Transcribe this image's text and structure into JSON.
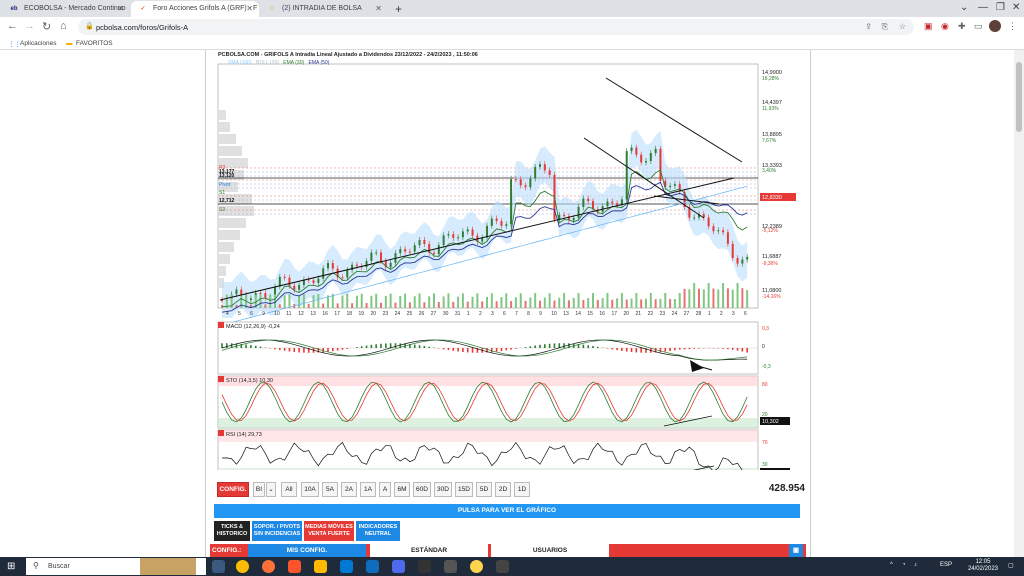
{
  "tabs": [
    {
      "label": "ECOBOLSA - Mercado Continuo",
      "fav": "eb",
      "favcolor": "#1a237e"
    },
    {
      "label": "Foro Acciones Grifols A (GRF) - F",
      "fav": "✓",
      "favcolor": "#ff5722"
    },
    {
      "label": "(2) INTRADIA DE BOLSA",
      "fav": "☺",
      "favcolor": "#ffc107"
    }
  ],
  "url": "pcbolsa.com/foros/Grifols-A",
  "bookmarks": [
    "Aplicaciones",
    "FAVORITOS"
  ],
  "chart": {
    "title": "PCBOLSA.COM - GRIFOLS A Intradía Lineal Ajustado a Dividendos 23/12/2022 - 24/2/2023 , 11:50:06",
    "legend": [
      "SMA (100)",
      "BOLL (20)",
      "EMA (30)",
      "EMA (50)"
    ],
    "price_labels": [
      "14,9900",
      "14,4397",
      "13,8895",
      "13,3393",
      "12,8330",
      "12,2389",
      "11,6887",
      "11,0800"
    ],
    "pct_labels": [
      "16,28%",
      "11,93%",
      "7,67%",
      "3,40%",
      "-5,12%",
      "-9,36%",
      "-14,16%"
    ],
    "level_labels": [
      "13,177",
      "13,120",
      "12,712",
      "R3",
      "Pivot",
      "S1",
      "S3"
    ],
    "dates": [
      "4",
      "5",
      "6",
      "9",
      "10",
      "11",
      "12",
      "13",
      "16",
      "17",
      "18",
      "19",
      "20",
      "23",
      "24",
      "25",
      "26",
      "27",
      "30",
      "31",
      "1",
      "2",
      "3",
      "6",
      "7",
      "8",
      "9",
      "10",
      "13",
      "14",
      "15",
      "16",
      "17",
      "20",
      "21",
      "22",
      "23",
      "24",
      "27",
      "28",
      "1",
      "2",
      "3",
      "6"
    ],
    "macd_label": "MACD (12,26,9)  -0,24",
    "macd_scale": [
      "0,3",
      "0",
      "-0,3"
    ],
    "sto_label": "STO (14,3,5)  10,30",
    "sto_scale": [
      "80",
      "20"
    ],
    "sto_value": "10,302",
    "rsi_label": "RSI (14)  29,73",
    "rsi_scale": [
      "70",
      "30"
    ],
    "rsi_value": "29,732"
  },
  "controls": {
    "config": "CONFIG.",
    "type": "BI",
    "all": "All",
    "ranges": [
      "10A",
      "5A",
      "2A",
      "1A",
      "A",
      "6M",
      "60D",
      "30D",
      "15D",
      "5D",
      "2D",
      "1D"
    ],
    "count": "428.954"
  },
  "cta": "PULSA PARA VER EL GRÁFICO",
  "menu": [
    {
      "l1": "TICKS &",
      "l2": "HISTORICO",
      "color": "#222"
    },
    {
      "l1": "SOPOR. / PIVOTS",
      "l2": "SIN INCIDENCIAS",
      "color": "#1e88e5"
    },
    {
      "l1": "MEDIAS MÓVILES",
      "l2": "VENTA FUERTE",
      "color": "#e53935"
    },
    {
      "l1": "INDICADORES",
      "l2": "NEUTRAL",
      "color": "#1e88e5"
    }
  ],
  "bottom": {
    "config": "CONFIG.:",
    "mis": "MIS CONFIG.",
    "estandar": "ESTÁNDAR",
    "usuarios": "USUARIOS"
  },
  "taskbar": {
    "search": "Buscar",
    "lang": "ESP",
    "time": "12:05",
    "date": "24/02/2023"
  }
}
